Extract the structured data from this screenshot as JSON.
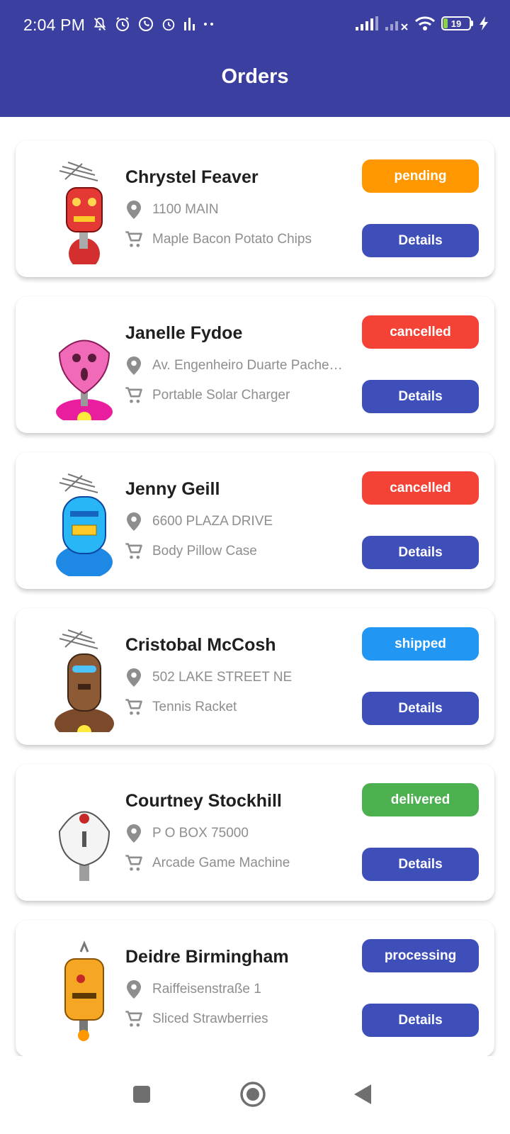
{
  "status_bar": {
    "time": "2:04 PM",
    "battery": "19"
  },
  "header": {
    "title": "Orders"
  },
  "details_label": "Details",
  "orders": [
    {
      "name": "Chrystel Feaver",
      "address": "1100 MAIN",
      "item": "Maple Bacon Potato Chips",
      "status": "pending",
      "status_color": "#ff9800",
      "robot": "red"
    },
    {
      "name": "Janelle Fydoe",
      "address": "Av. Engenheiro Duarte Pache…",
      "item": "Portable Solar Charger",
      "status": "cancelled",
      "status_color": "#f44336",
      "robot": "pink"
    },
    {
      "name": "Jenny Geill",
      "address": "6600 PLAZA DRIVE",
      "item": "Body Pillow Case",
      "status": "cancelled",
      "status_color": "#f44336",
      "robot": "blue"
    },
    {
      "name": "Cristobal McCosh",
      "address": "502 LAKE STREET NE",
      "item": "Tennis Racket",
      "status": "shipped",
      "status_color": "#2196f3",
      "robot": "brown"
    },
    {
      "name": "Courtney Stockhill",
      "address": "P O BOX 75000",
      "item": "Arcade Game Machine",
      "status": "delivered",
      "status_color": "#4caf50",
      "robot": "white"
    },
    {
      "name": "Deidre Birmingham",
      "address": "Raiffeisenstraße 1",
      "item": "Sliced Strawberries",
      "status": "processing",
      "status_color": "#3f4fba",
      "robot": "orange"
    }
  ],
  "icons": {
    "location": "location-pin-icon",
    "cart": "shopping-cart-icon"
  },
  "colors": {
    "primary": "#3a3fa0",
    "button": "#3f4fba"
  }
}
